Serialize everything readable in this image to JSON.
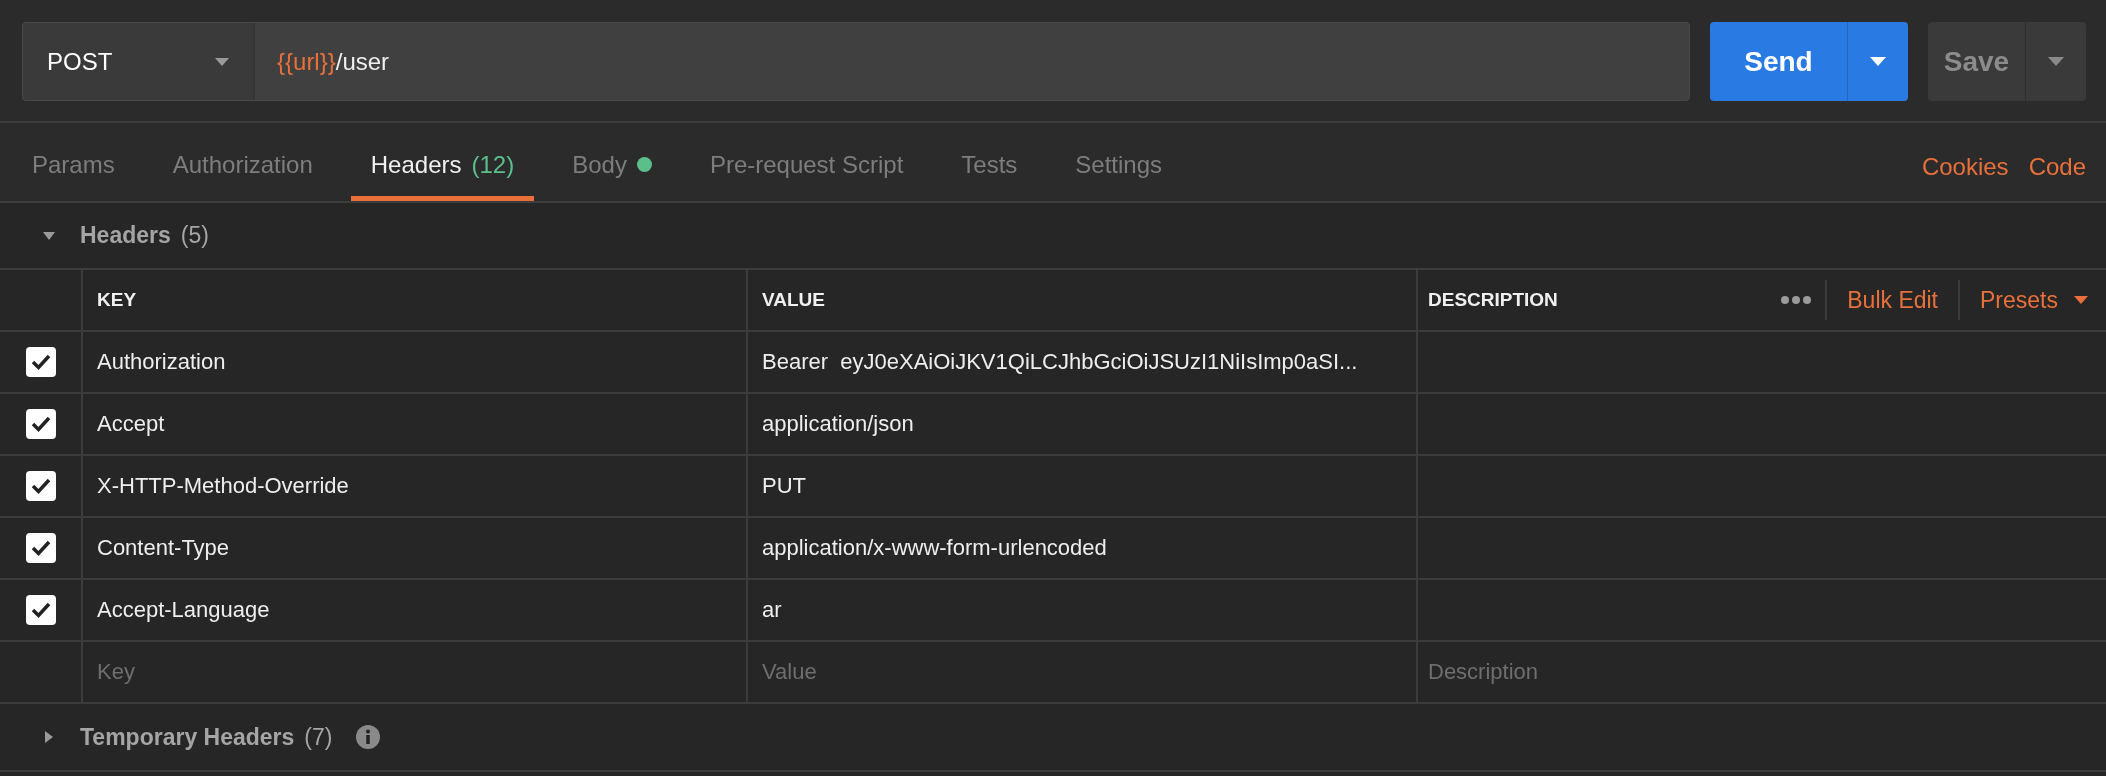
{
  "request": {
    "method": "POST",
    "url_parts": [
      {
        "kind": "variable",
        "text": "{{url}}"
      },
      {
        "kind": "text",
        "text": "/user"
      }
    ]
  },
  "send_button": {
    "label": "Send"
  },
  "save_button": {
    "label": "Save"
  },
  "tabs": [
    {
      "label": "Params",
      "selected": false
    },
    {
      "label": "Authorization",
      "selected": false
    },
    {
      "label": "Headers",
      "count": "(12)",
      "selected": true
    },
    {
      "label": "Body",
      "dot": true,
      "selected": false
    },
    {
      "label": "Pre-request Script",
      "selected": false
    },
    {
      "label": "Tests",
      "selected": false
    },
    {
      "label": "Settings",
      "selected": false
    }
  ],
  "links": [
    "Cookies",
    "Code"
  ],
  "headers_section": {
    "title": "Headers",
    "count": "(5)",
    "expanded": true
  },
  "table": {
    "columns": [
      "KEY",
      "VALUE",
      "DESCRIPTION"
    ],
    "actions": {
      "bulk_edit": "Bulk Edit",
      "presets": "Presets"
    },
    "rows": [
      {
        "checked": true,
        "key": "Authorization",
        "value": "Bearer  eyJ0eXAiOiJKV1QiLCJhbGciOiJSUzI1NiIsImp0aSI..."
      },
      {
        "checked": true,
        "key": "Accept",
        "value": "application/json"
      },
      {
        "checked": true,
        "key": "X-HTTP-Method-Override",
        "value": "PUT"
      },
      {
        "checked": true,
        "key": "Content-Type",
        "value": "application/x-www-form-urlencoded"
      },
      {
        "checked": true,
        "key": "Accept-Language",
        "value": "ar"
      }
    ],
    "new_row": {
      "key_placeholder": "Key",
      "value_placeholder": "Value",
      "description_placeholder": "Description"
    }
  },
  "temporary_headers": {
    "title": "Temporary Headers",
    "count": "(7)",
    "expanded": false
  }
}
